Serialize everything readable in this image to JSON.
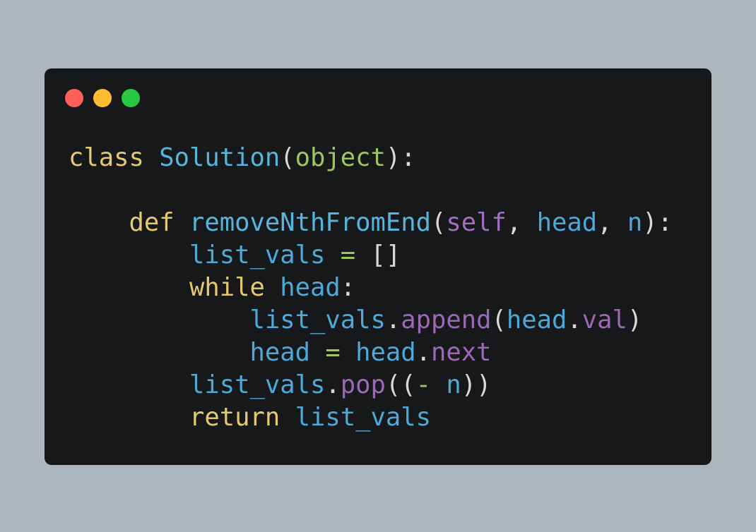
{
  "theme": {
    "background": "#abb6bf",
    "window": "#17181a",
    "traffic_red": "#ff5f57",
    "traffic_yellow": "#febc2e",
    "traffic_green": "#28c840"
  },
  "code": {
    "lines": [
      [
        {
          "text": "class",
          "type": "kw"
        },
        {
          "text": " ",
          "type": "punct"
        },
        {
          "text": "Solution",
          "type": "cls"
        },
        {
          "text": "(",
          "type": "punct"
        },
        {
          "text": "object",
          "type": "builtin"
        },
        {
          "text": "):",
          "type": "punct"
        }
      ],
      [],
      [
        {
          "text": "    ",
          "type": "punct"
        },
        {
          "text": "def",
          "type": "kw"
        },
        {
          "text": " ",
          "type": "punct"
        },
        {
          "text": "removeNthFromEnd",
          "type": "cls"
        },
        {
          "text": "(",
          "type": "punct"
        },
        {
          "text": "self",
          "type": "self"
        },
        {
          "text": ", ",
          "type": "punct"
        },
        {
          "text": "head",
          "type": "var"
        },
        {
          "text": ", ",
          "type": "punct"
        },
        {
          "text": "n",
          "type": "var"
        },
        {
          "text": "):",
          "type": "punct"
        }
      ],
      [
        {
          "text": "        ",
          "type": "punct"
        },
        {
          "text": "list_vals",
          "type": "var"
        },
        {
          "text": " ",
          "type": "punct"
        },
        {
          "text": "=",
          "type": "op"
        },
        {
          "text": " ",
          "type": "punct"
        },
        {
          "text": "[]",
          "type": "punct"
        }
      ],
      [
        {
          "text": "        ",
          "type": "punct"
        },
        {
          "text": "while",
          "type": "kw"
        },
        {
          "text": " ",
          "type": "punct"
        },
        {
          "text": "head",
          "type": "var"
        },
        {
          "text": ":",
          "type": "punct"
        }
      ],
      [
        {
          "text": "            ",
          "type": "punct"
        },
        {
          "text": "list_vals",
          "type": "var"
        },
        {
          "text": ".",
          "type": "punct"
        },
        {
          "text": "append",
          "type": "attr"
        },
        {
          "text": "(",
          "type": "punct"
        },
        {
          "text": "head",
          "type": "var"
        },
        {
          "text": ".",
          "type": "punct"
        },
        {
          "text": "val",
          "type": "attr"
        },
        {
          "text": ")",
          "type": "punct"
        }
      ],
      [
        {
          "text": "            ",
          "type": "punct"
        },
        {
          "text": "head",
          "type": "var"
        },
        {
          "text": " ",
          "type": "punct"
        },
        {
          "text": "=",
          "type": "op"
        },
        {
          "text": " ",
          "type": "punct"
        },
        {
          "text": "head",
          "type": "var"
        },
        {
          "text": ".",
          "type": "punct"
        },
        {
          "text": "next",
          "type": "attr"
        }
      ],
      [
        {
          "text": "        ",
          "type": "punct"
        },
        {
          "text": "list_vals",
          "type": "var"
        },
        {
          "text": ".",
          "type": "punct"
        },
        {
          "text": "pop",
          "type": "attr"
        },
        {
          "text": "((",
          "type": "punct"
        },
        {
          "text": "-",
          "type": "op"
        },
        {
          "text": " ",
          "type": "punct"
        },
        {
          "text": "n",
          "type": "var"
        },
        {
          "text": "))",
          "type": "punct"
        }
      ],
      [
        {
          "text": "        ",
          "type": "punct"
        },
        {
          "text": "return",
          "type": "kw"
        },
        {
          "text": " ",
          "type": "punct"
        },
        {
          "text": "list_vals",
          "type": "var"
        }
      ]
    ]
  }
}
